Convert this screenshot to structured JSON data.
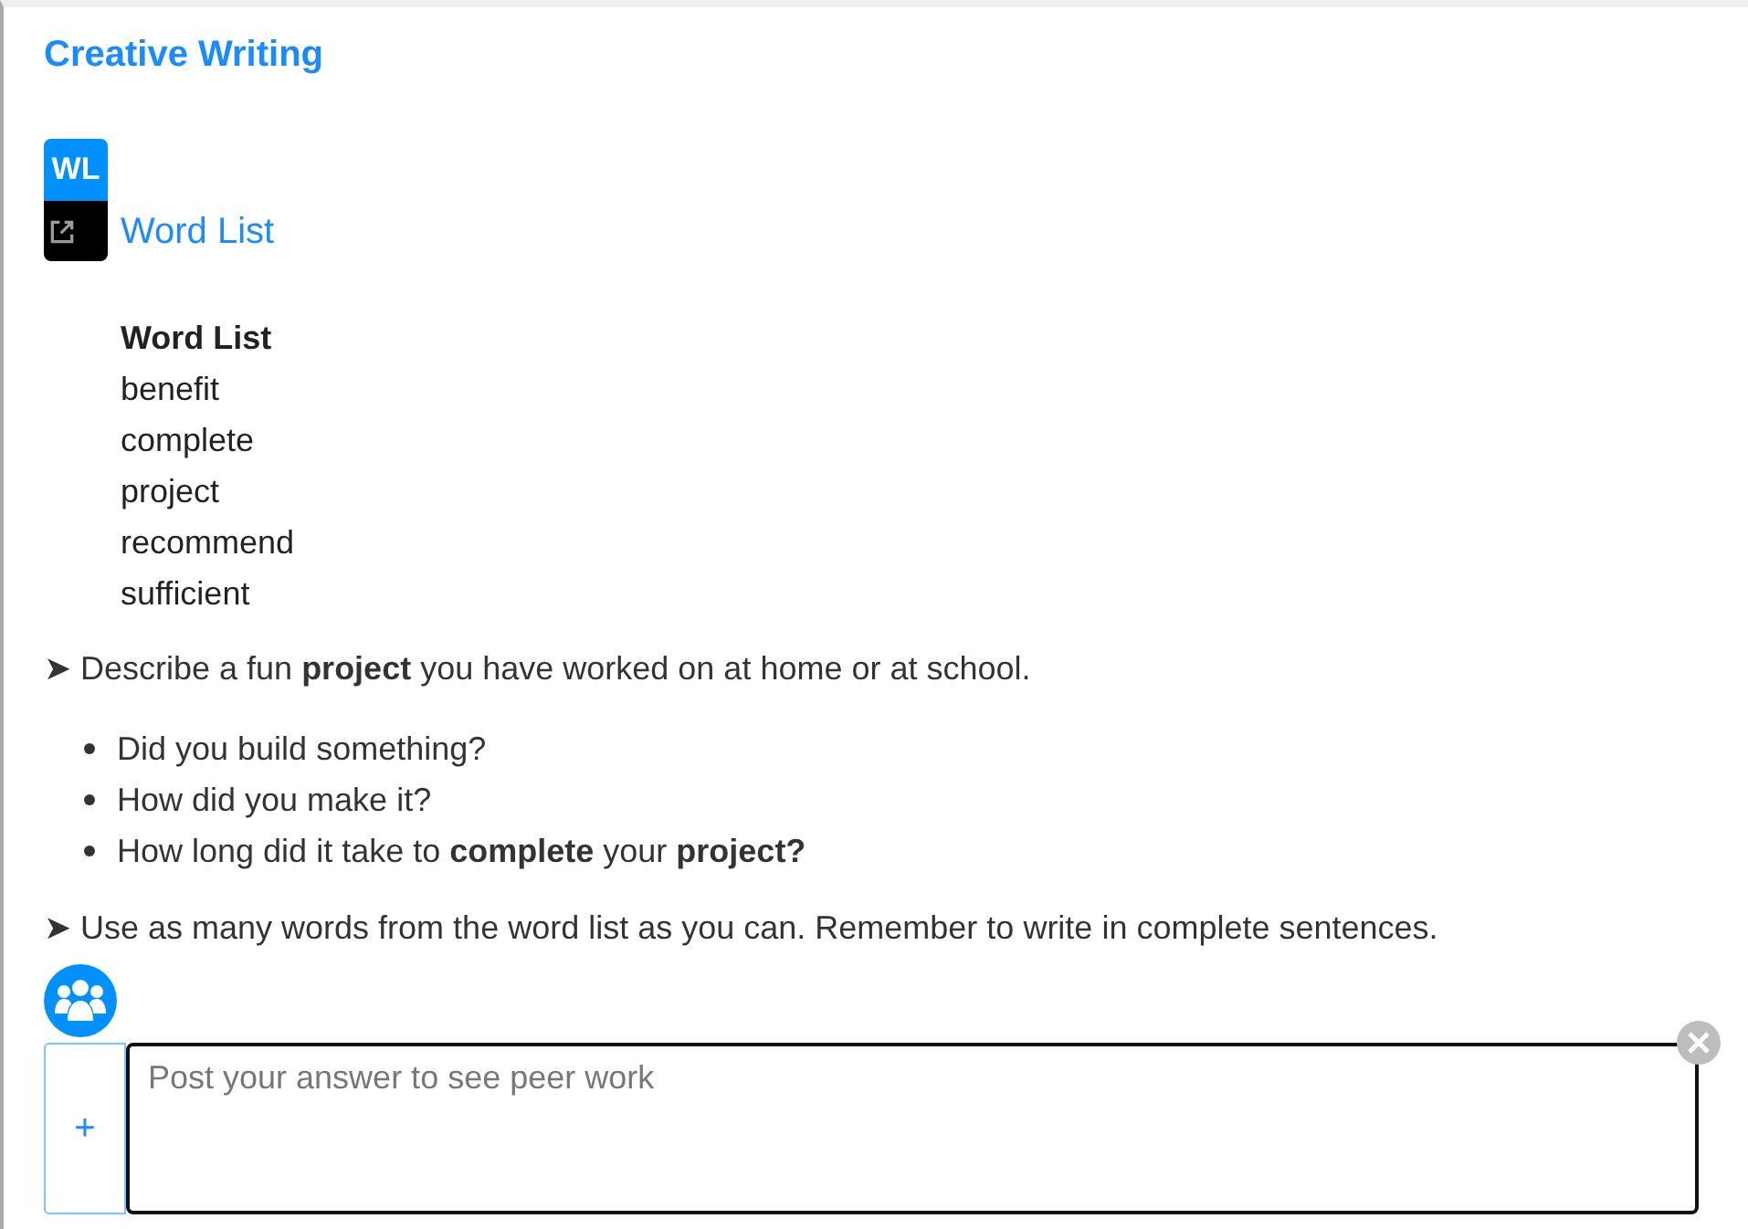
{
  "title": "Creative Writing",
  "resource": {
    "badge": "WL",
    "link": "Word List"
  },
  "word_list": {
    "heading": "Word List",
    "words": [
      "benefit",
      "complete",
      "project",
      "recommend",
      "sufficient"
    ]
  },
  "prompt": "➤ Describe a fun **project** you have worked on at home or at school.",
  "questions": [
    "Did you build something?",
    "How did you make it?",
    "How long did it take to **complete** your **project?**"
  ],
  "instruction": "➤ Use as many words from the word list as you can. Remember to write in complete sentences.",
  "answer": {
    "add_button": "+",
    "placeholder": "Post your answer to see peer work"
  }
}
